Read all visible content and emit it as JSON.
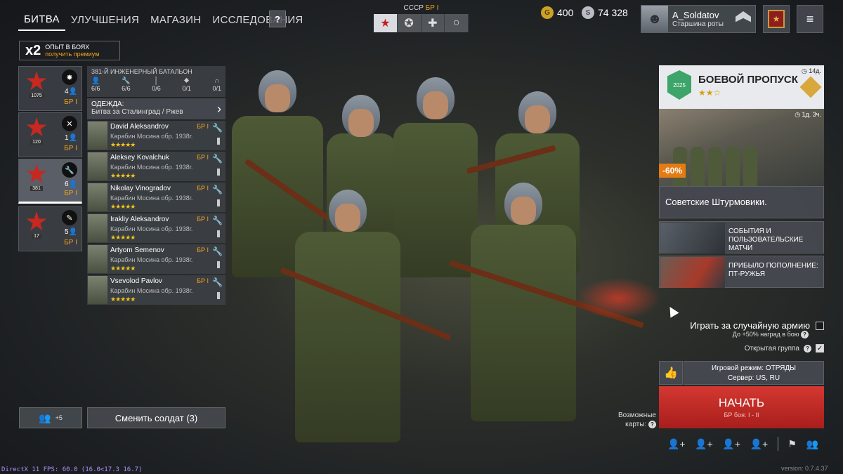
{
  "nav": {
    "tabs": [
      "БИТВА",
      "УЛУЧШЕНИЯ",
      "МАГАЗИН",
      "ИССЛЕДОВАНИЯ"
    ],
    "active_tab": "БИТВА",
    "help": "?"
  },
  "nation": {
    "label": "СССР",
    "br": "БР I",
    "tabs": [
      "star",
      "circle-star",
      "cross",
      "ring"
    ]
  },
  "currency": {
    "gold": "400",
    "silver": "74 328"
  },
  "profile": {
    "name": "A_Soldatov",
    "rank": "Старшина роты"
  },
  "menu_icon": "≡",
  "exp_bonus": {
    "mult": "x2",
    "line1": "ОПЫТ В БОЯХ",
    "line2": "получить премиум"
  },
  "squads": [
    {
      "emblem_num": "1075",
      "count": "4",
      "br": "БР I",
      "icon": "explosion-icon",
      "active": false
    },
    {
      "emblem_num": "120",
      "count": "1",
      "br": "БР I",
      "icon": "crossed-tools-icon",
      "active": false
    },
    {
      "emblem_num": "381",
      "count": "6",
      "br": "БР I",
      "icon": "wrench-icon",
      "active": true
    },
    {
      "emblem_num": "17",
      "count": "5",
      "br": "БР I",
      "icon": "feather-icon",
      "active": false
    }
  ],
  "battalion": {
    "title": "381-Й ИНЖЕНЕРНЫЙ БАТАЛЬОН",
    "stats": [
      {
        "icon": "person-icon",
        "value": "6/6"
      },
      {
        "icon": "wrench-icon",
        "value": "6/6"
      },
      {
        "icon": "rifle-icon",
        "value": "0/6"
      },
      {
        "icon": "explosion-icon",
        "value": "0/1"
      },
      {
        "icon": "headset-icon",
        "value": "0/1"
      }
    ]
  },
  "clothes": {
    "label": "ОДЕЖДА:",
    "value": "Битва за Сталинград / Ржев"
  },
  "soldiers": [
    {
      "name": "David Aleksandrov",
      "weapon": "Карабин Мосина обр. 1938г.",
      "br": "БР I",
      "stars": "★★★★★"
    },
    {
      "name": "Aleksey Kovalchuk",
      "weapon": "Карабин Мосина обр. 1938г.",
      "br": "БР I",
      "stars": "★★★★★"
    },
    {
      "name": "Nikolay Vinogradov",
      "weapon": "Карабин Мосина обр. 1938г.",
      "br": "БР I",
      "stars": "★★★★★"
    },
    {
      "name": "Irakliy Aleksandrov",
      "weapon": "Карабин Мосина обр. 1938г.",
      "br": "БР I",
      "stars": "★★★★★"
    },
    {
      "name": "Artyom Semenov",
      "weapon": "Карабин Мосина обр. 1938г.",
      "br": "БР I",
      "stars": "★★★★★"
    },
    {
      "name": "Vsevolod Pavlov",
      "weapon": "Карабин Мосина обр. 1938г.",
      "br": "БР I",
      "stars": "★★★★★"
    }
  ],
  "squad_invite": {
    "count": "+5"
  },
  "change_soldier": "Сменить солдат (3)",
  "battle_pass": {
    "title": "БОЕВОЙ ПРОПУСК",
    "stars": "★★☆",
    "days": "14д.",
    "year": "2025"
  },
  "promo": {
    "discount": "-60%",
    "timer": "1д. 3ч.",
    "title": "Советские Штурмовики."
  },
  "news": [
    {
      "text": "СОБЫТИЯ И ПОЛЬЗОВАТЕЛЬСКИЕ МАТЧИ"
    },
    {
      "text": "ПРИБЫЛО ПОПОЛНЕНИЕ: ПТ-РУЖЬЯ"
    }
  ],
  "random_army": {
    "label": "Играть за случайную армию",
    "bonus": "До +50% наград в бою"
  },
  "open_group": {
    "label": "Открытая группа",
    "checked": true
  },
  "mode": {
    "line1": "Игровой режим: ОТРЯДЫ",
    "line2": "Сервер: US, RU"
  },
  "start": {
    "label": "НАЧАТЬ",
    "sub": "БР боя: I - II"
  },
  "maps": {
    "label": "Возможные карты:"
  },
  "debug": {
    "fps": "DirectX 11 FPS: 60.0 (16.0<17.3 16.7)",
    "version": "version: 0.7.4.37"
  }
}
